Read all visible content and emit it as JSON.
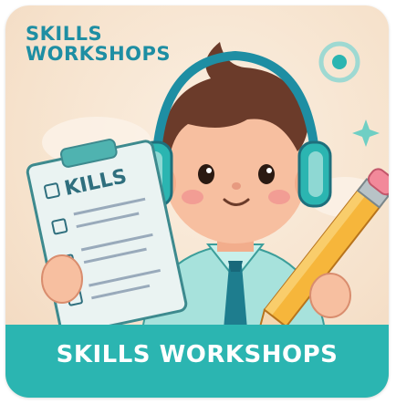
{
  "top_title": {
    "line1": "SKILLS",
    "line2": "WORKSHOPS"
  },
  "clipboard_text": "KILLS",
  "banner": {
    "text": "SKILLS WORKSHOPS"
  },
  "colors": {
    "teal": "#2bb5b1",
    "title_blue": "#1e8ea3",
    "background": "#f6e2cc",
    "hair": "#6b3b2a",
    "skin": "#f7bfa0",
    "pencil": "#f6b63b"
  },
  "icons": [
    "headphones-icon",
    "clipboard-icon",
    "pencil-icon",
    "sparkle-icon",
    "ring-icon"
  ]
}
